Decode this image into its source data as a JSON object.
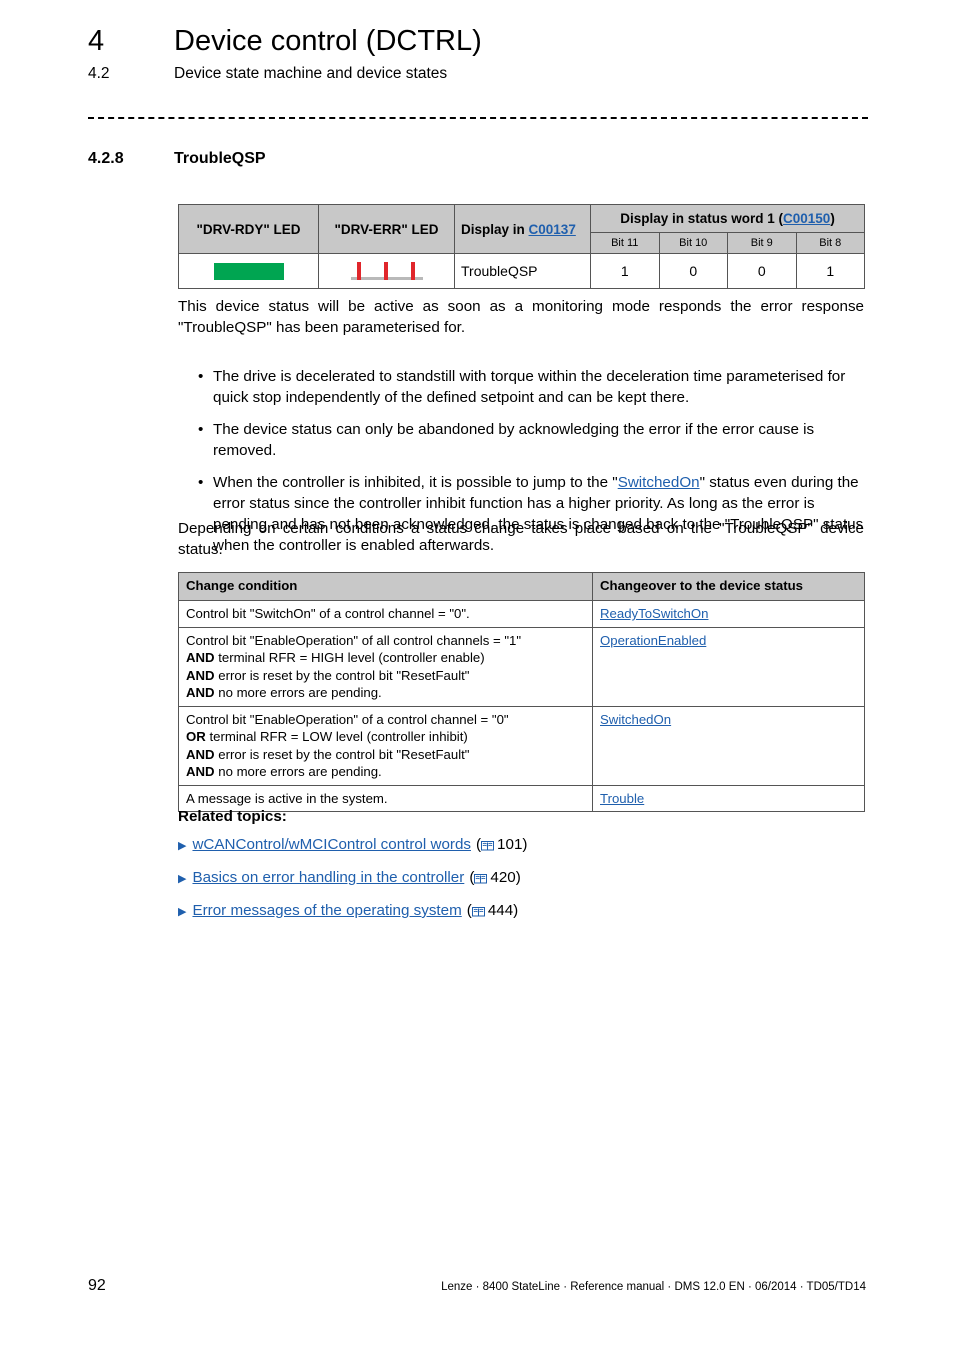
{
  "header": {
    "chapter_number": "4",
    "chapter_title": "Device control (DCTRL)",
    "section_number": "4.2",
    "section_title": "Device state machine and device states"
  },
  "section": {
    "number": "4.2.8",
    "title": "TroubleQSP"
  },
  "led_table": {
    "headers": {
      "drv_rdy": "\"DRV-RDY\" LED",
      "drv_err": "\"DRV-ERR\" LED",
      "display_in_prefix": "Display in ",
      "display_in_link": "C00137",
      "status_word_prefix": "Display in status word 1 (",
      "status_word_link": "C00150",
      "status_word_suffix": ")"
    },
    "bit_headers": [
      "Bit 11",
      "Bit 10",
      "Bit 9",
      "Bit 8"
    ],
    "row": {
      "drv_rdy_state": "solid-green",
      "drv_err_state": "blinking-red",
      "display_value": "TroubleQSP",
      "bits": [
        "1",
        "0",
        "0",
        "1"
      ]
    },
    "colors": {
      "led_green": "#00A551",
      "led_red": "#E0262B",
      "header_bg": "#c8c8c8",
      "link": "#1F5FAD"
    }
  },
  "intro_paragraph": "This device status will be active as soon as a monitoring mode responds the error response \"TroubleQSP\" has been parameterised for.",
  "bullets": [
    {
      "text": "The drive is decelerated to standstill with torque within the deceleration time parameterised for quick stop independently of the defined setpoint and can be kept there."
    },
    {
      "text": "The device status can only be abandoned by acknowledging the error if the error cause is removed."
    },
    {
      "part1": "When the controller is inhibited, it is possible to jump to the \"",
      "link": "SwitchedOn",
      "part2": "\" status even during the error status since the controller inhibit function has a higher priority. As long as the error is pending and has not been acknowledged, the status is changed back to the \"TroubleQSP\" status when the controller is enabled afterwards."
    }
  ],
  "depending_paragraph": "Depending on certain conditions a status change takes place based on the \"TroubleQSP\" device status.",
  "condition_table": {
    "headers": [
      "Change condition",
      "Changeover to the device status"
    ],
    "rows": [
      {
        "lines": [
          {
            "bold": "",
            "text": "Control bit \"SwitchOn\" of a control channel = \"0\"."
          }
        ],
        "status": "ReadyToSwitchOn"
      },
      {
        "lines": [
          {
            "bold": "",
            "text": "Control bit \"EnableOperation\" of all control channels = \"1\""
          },
          {
            "bold": "AND",
            "text": " terminal RFR = HIGH level (controller enable)"
          },
          {
            "bold": "AND",
            "text": " error is reset by the control bit \"ResetFault\""
          },
          {
            "bold": "AND",
            "text": " no more errors are pending."
          }
        ],
        "status": "OperationEnabled"
      },
      {
        "lines": [
          {
            "bold": "",
            "text": "Control bit \"EnableOperation\" of a control channel = \"0\""
          },
          {
            "bold": "OR",
            "text": " terminal RFR = LOW level (controller inhibit)"
          },
          {
            "bold": "AND",
            "text": " error is reset by the control bit \"ResetFault\""
          },
          {
            "bold": "AND",
            "text": " no more errors are pending."
          }
        ],
        "status": "SwitchedOn"
      },
      {
        "lines": [
          {
            "bold": "",
            "text": "A message is active in the system."
          }
        ],
        "status": "Trouble"
      }
    ]
  },
  "related_topics": {
    "title": "Related topics:",
    "items": [
      {
        "label": "wCANControl/wMCIControl control words",
        "page": "101"
      },
      {
        "label": "Basics on error handling in the controller",
        "page": "420"
      },
      {
        "label": "Error messages of the operating system",
        "page": "444"
      }
    ]
  },
  "footer": {
    "page_number": "92",
    "text": "Lenze · 8400 StateLine · Reference manual · DMS 12.0 EN · 06/2014 · TD05/TD14"
  }
}
